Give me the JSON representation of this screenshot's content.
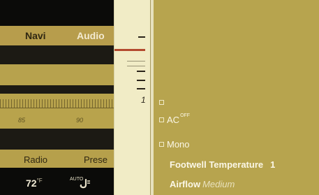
{
  "audio": {
    "tabs": [
      "Navi",
      "Audio"
    ],
    "active_tab": "Audio",
    "scale_labels": [
      "85",
      "90"
    ],
    "bottom_tabs": [
      "Radio",
      "Prese"
    ]
  },
  "status": {
    "temperature": "72",
    "temperature_unit": "°F",
    "auto_label": "AUTO"
  },
  "slider": {
    "level_number": "1"
  },
  "menu": {
    "items": [
      {
        "label": "",
        "checkbox": true
      },
      {
        "label": "AC",
        "suffix": "OFF",
        "checkbox": true
      },
      {
        "label": "Mono",
        "checkbox": true
      },
      {
        "label": "Footwell Temperature",
        "value": "1"
      },
      {
        "label": "Airflow",
        "value": "Medium"
      }
    ]
  },
  "colors": {
    "panel_gold": "#b7a44e",
    "dark_bg": "#1a1a16",
    "slider_bg": "#f1ecc6",
    "indicator": "#b34a2e",
    "menu_text": "#fbf7e6"
  }
}
